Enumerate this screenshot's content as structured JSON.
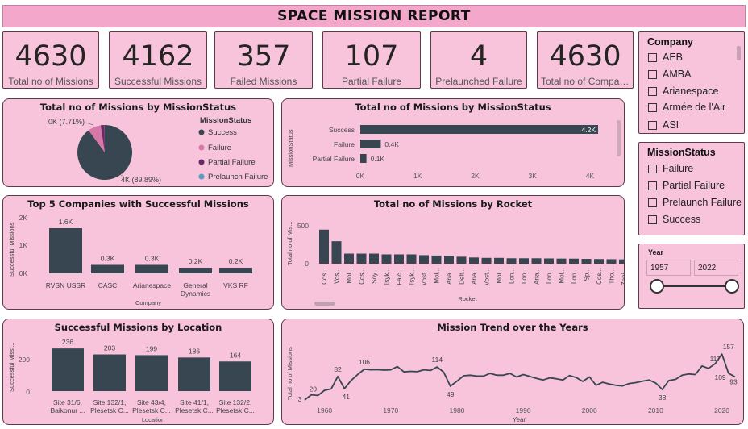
{
  "header": {
    "title": "SPACE MISSION REPORT"
  },
  "kpis": [
    {
      "value": "4630",
      "label": "Total no of Missions"
    },
    {
      "value": "4162",
      "label": "Successful Missions"
    },
    {
      "value": "357",
      "label": "Failed Missions"
    },
    {
      "value": "107",
      "label": "Partial Failure"
    },
    {
      "value": "4",
      "label": "Prelaunched Failure"
    },
    {
      "value": "4630",
      "label": "Total no of Compan..."
    }
  ],
  "pie_panel": {
    "title": "Total no of Missions by MissionStatus",
    "legend_title": "MissionStatus",
    "legend": [
      "Success",
      "Failure",
      "Partial Failure",
      "Prelaunch Failure"
    ],
    "label_small": "0K (7.71%)",
    "label_big": "4K (89.89%)"
  },
  "bar_status_panel": {
    "title": "Total no of Missions by MissionStatus",
    "ylabel": "MissionStatus",
    "ticks": [
      "0K",
      "1K",
      "2K",
      "3K",
      "4K"
    ],
    "data_labels": [
      "4.2K",
      "0.4K",
      "0.1K"
    ]
  },
  "top5_panel": {
    "title": "Top 5 Companies with Successful Missions",
    "ylabel": "Successful Missions",
    "xlabel": "Company",
    "yticks": [
      "2K",
      "1K",
      "0K"
    ],
    "data_labels": [
      "1.6K",
      "0.3K",
      "0.3K",
      "0.2K",
      "0.2K"
    ],
    "cat_labels": [
      "RVSN USSR",
      "CASC",
      "Arianespace",
      "General Dynamics",
      "VKS RF"
    ]
  },
  "rocket_panel": {
    "title": "Total no of Missions by Rocket",
    "ylabel": "Total no of Mis...",
    "xlabel": "Rocket",
    "yticks": [
      "500",
      "0"
    ],
    "cat_labels": [
      "Cos...",
      "Vos...",
      "Mol...",
      "Cos...",
      "Soy...",
      "Tsyk...",
      "Falc...",
      "Tsyk...",
      "Vost...",
      "Mol...",
      "Aria...",
      "Delt...",
      "Aria...",
      "Vost...",
      "Mol...",
      "Lon...",
      "Lon...",
      "Aria...",
      "Lon...",
      "Mol...",
      "Lon...",
      "Sp...",
      "Cos...",
      "Tho...",
      "Zeni..."
    ]
  },
  "location_panel": {
    "title": "Successful Missions by Location",
    "ylabel": "Successful Missi...",
    "xlabel": "Location",
    "yticks": [
      "200",
      "0"
    ],
    "data_labels": [
      "236",
      "203",
      "199",
      "186",
      "164"
    ],
    "cat_line1": [
      "Site 31/6,",
      "Site 132/1,",
      "Site 43/4,",
      "Site 41/1,",
      "Site 132/2,"
    ],
    "cat_line2": [
      "Baikonur ...",
      "Plesetsk C...",
      "Plesetsk C...",
      "Plesetsk C...",
      "Plesetsk C..."
    ]
  },
  "trend_panel": {
    "title": "Mission Trend over the Years",
    "ylabel": "Total no of Missions",
    "xlabel": "Year",
    "xticks": [
      "1960",
      "1970",
      "1980",
      "1990",
      "2000",
      "2010",
      "2020"
    ],
    "point_labels": [
      "3",
      "20",
      "82",
      "41",
      "106",
      "114",
      "49",
      "38",
      "117",
      "109",
      "157",
      "93"
    ]
  },
  "company_slicer": {
    "title": "Company",
    "items": [
      "AEB",
      "AMBA",
      "Arianespace",
      "Armée de l'Air",
      "ASI"
    ]
  },
  "status_slicer": {
    "title": "MissionStatus",
    "items": [
      "Failure",
      "Partial Failure",
      "Prelaunch Failure",
      "Success"
    ]
  },
  "year_slicer": {
    "title": "Year",
    "from": "1957",
    "to": "2022"
  },
  "colors": {
    "bar": "#374650",
    "pie_success": "#374650",
    "pie_failure": "#d678a8",
    "pie_partial": "#6b2a66",
    "pie_prelaunch": "#5a9bbf",
    "panel_bg": "#f7c4dc"
  },
  "chart_data": [
    {
      "type": "pie",
      "title": "Total no of Missions by MissionStatus",
      "categories": [
        "Success",
        "Failure",
        "Partial Failure",
        "Prelaunch Failure"
      ],
      "values": [
        4162,
        357,
        107,
        4
      ],
      "legend": "right"
    },
    {
      "type": "bar",
      "title": "Total no of Missions by MissionStatus",
      "orientation": "horizontal",
      "categories": [
        "Success",
        "Failure",
        "Partial Failure"
      ],
      "values": [
        4162,
        357,
        107
      ],
      "xlim": [
        0,
        4000
      ],
      "ylabel": "MissionStatus"
    },
    {
      "type": "bar",
      "title": "Top 5 Companies with Successful Missions",
      "categories": [
        "RVSN USSR",
        "CASC",
        "Arianespace",
        "General Dynamics",
        "VKS RF"
      ],
      "values": [
        1600,
        300,
        300,
        200,
        200
      ],
      "ylim": [
        0,
        2000
      ],
      "xlabel": "Company",
      "ylabel": "Successful Missions"
    },
    {
      "type": "bar",
      "title": "Total no of Missions by Rocket",
      "values": [
        440,
        290,
        130,
        130,
        130,
        120,
        120,
        120,
        110,
        105,
        100,
        90,
        80,
        75,
        75,
        70,
        70,
        70,
        68,
        66,
        65,
        62,
        60,
        58,
        56
      ],
      "ylim": [
        0,
        500
      ],
      "xlabel": "Rocket",
      "ylabel": "Total no of Mis..."
    },
    {
      "type": "bar",
      "title": "Successful Missions by Location",
      "categories": [
        "Site 31/6, Baikonur ...",
        "Site 132/1, Plesetsk C...",
        "Site 43/4, Plesetsk C...",
        "Site 41/1, Plesetsk C...",
        "Site 132/2, Plesetsk C..."
      ],
      "values": [
        236,
        203,
        199,
        186,
        164
      ],
      "ylim": [
        0,
        250
      ],
      "xlabel": "Location",
      "ylabel": "Successful Missi..."
    },
    {
      "type": "line",
      "title": "Mission Trend over the Years",
      "x": [
        1957,
        1958,
        1959,
        1960,
        1961,
        1962,
        1963,
        1964,
        1965,
        1966,
        1967,
        1968,
        1969,
        1970,
        1971,
        1972,
        1973,
        1974,
        1975,
        1976,
        1977,
        1978,
        1979,
        1980,
        1981,
        1982,
        1983,
        1984,
        1985,
        1986,
        1987,
        1988,
        1989,
        1990,
        1991,
        1992,
        1993,
        1994,
        1995,
        1996,
        1997,
        1998,
        1999,
        2000,
        2001,
        2002,
        2003,
        2004,
        2005,
        2006,
        2007,
        2008,
        2009,
        2010,
        2011,
        2012,
        2013,
        2014,
        2015,
        2016,
        2017,
        2018,
        2019,
        2020,
        2021,
        2022
      ],
      "y": [
        3,
        20,
        18,
        35,
        40,
        82,
        41,
        68,
        88,
        106,
        104,
        105,
        103,
        104,
        115,
        97,
        99,
        98,
        104,
        102,
        114,
        96,
        49,
        66,
        84,
        86,
        83,
        83,
        92,
        86,
        86,
        92,
        80,
        88,
        82,
        75,
        70,
        77,
        74,
        70,
        85,
        78,
        65,
        80,
        52,
        62,
        56,
        52,
        50,
        58,
        61,
        66,
        70,
        60,
        38,
        68,
        72,
        86,
        90,
        88,
        117,
        109,
        125,
        157,
        93,
        80
      ],
      "xlim": [
        1957,
        2022
      ],
      "ylim": [
        0,
        160
      ],
      "xlabel": "Year",
      "ylabel": "Total no of Missions"
    }
  ]
}
